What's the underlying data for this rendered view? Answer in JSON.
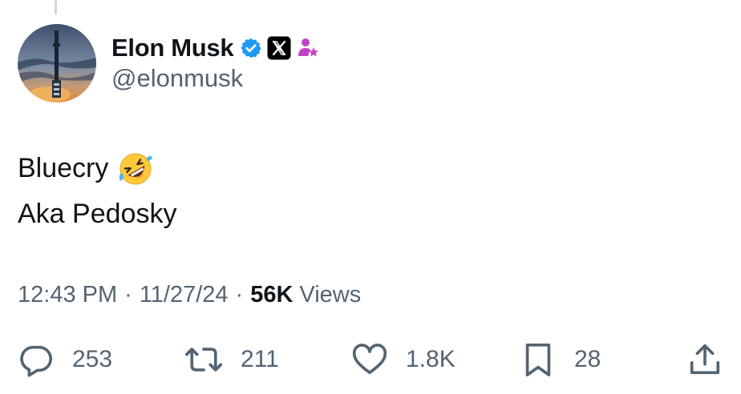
{
  "author": {
    "display_name": "Elon Musk",
    "handle": "@elonmusk",
    "badges": [
      "verified-check-icon",
      "x-affiliate-badge-icon",
      "person-star-icon"
    ],
    "verified_color": "#1d9bf0",
    "affiliate_color": "#c341c9"
  },
  "tweet": {
    "line1": "Bluecry",
    "line1_emoji": "rolling-on-floor-laughing-emoji",
    "line2": "Aka Pedosky"
  },
  "meta": {
    "time": "12:43 PM",
    "separator": "·",
    "date": "11/27/24",
    "views_count": "56K",
    "views_label": "Views"
  },
  "actions": {
    "replies": {
      "icon": "reply-icon",
      "count": "253"
    },
    "reposts": {
      "icon": "repost-icon",
      "count": "211"
    },
    "likes": {
      "icon": "heart-icon",
      "count": "1.8K"
    },
    "bookmarks": {
      "icon": "bookmark-icon",
      "count": "28"
    },
    "share": {
      "icon": "share-icon"
    }
  }
}
